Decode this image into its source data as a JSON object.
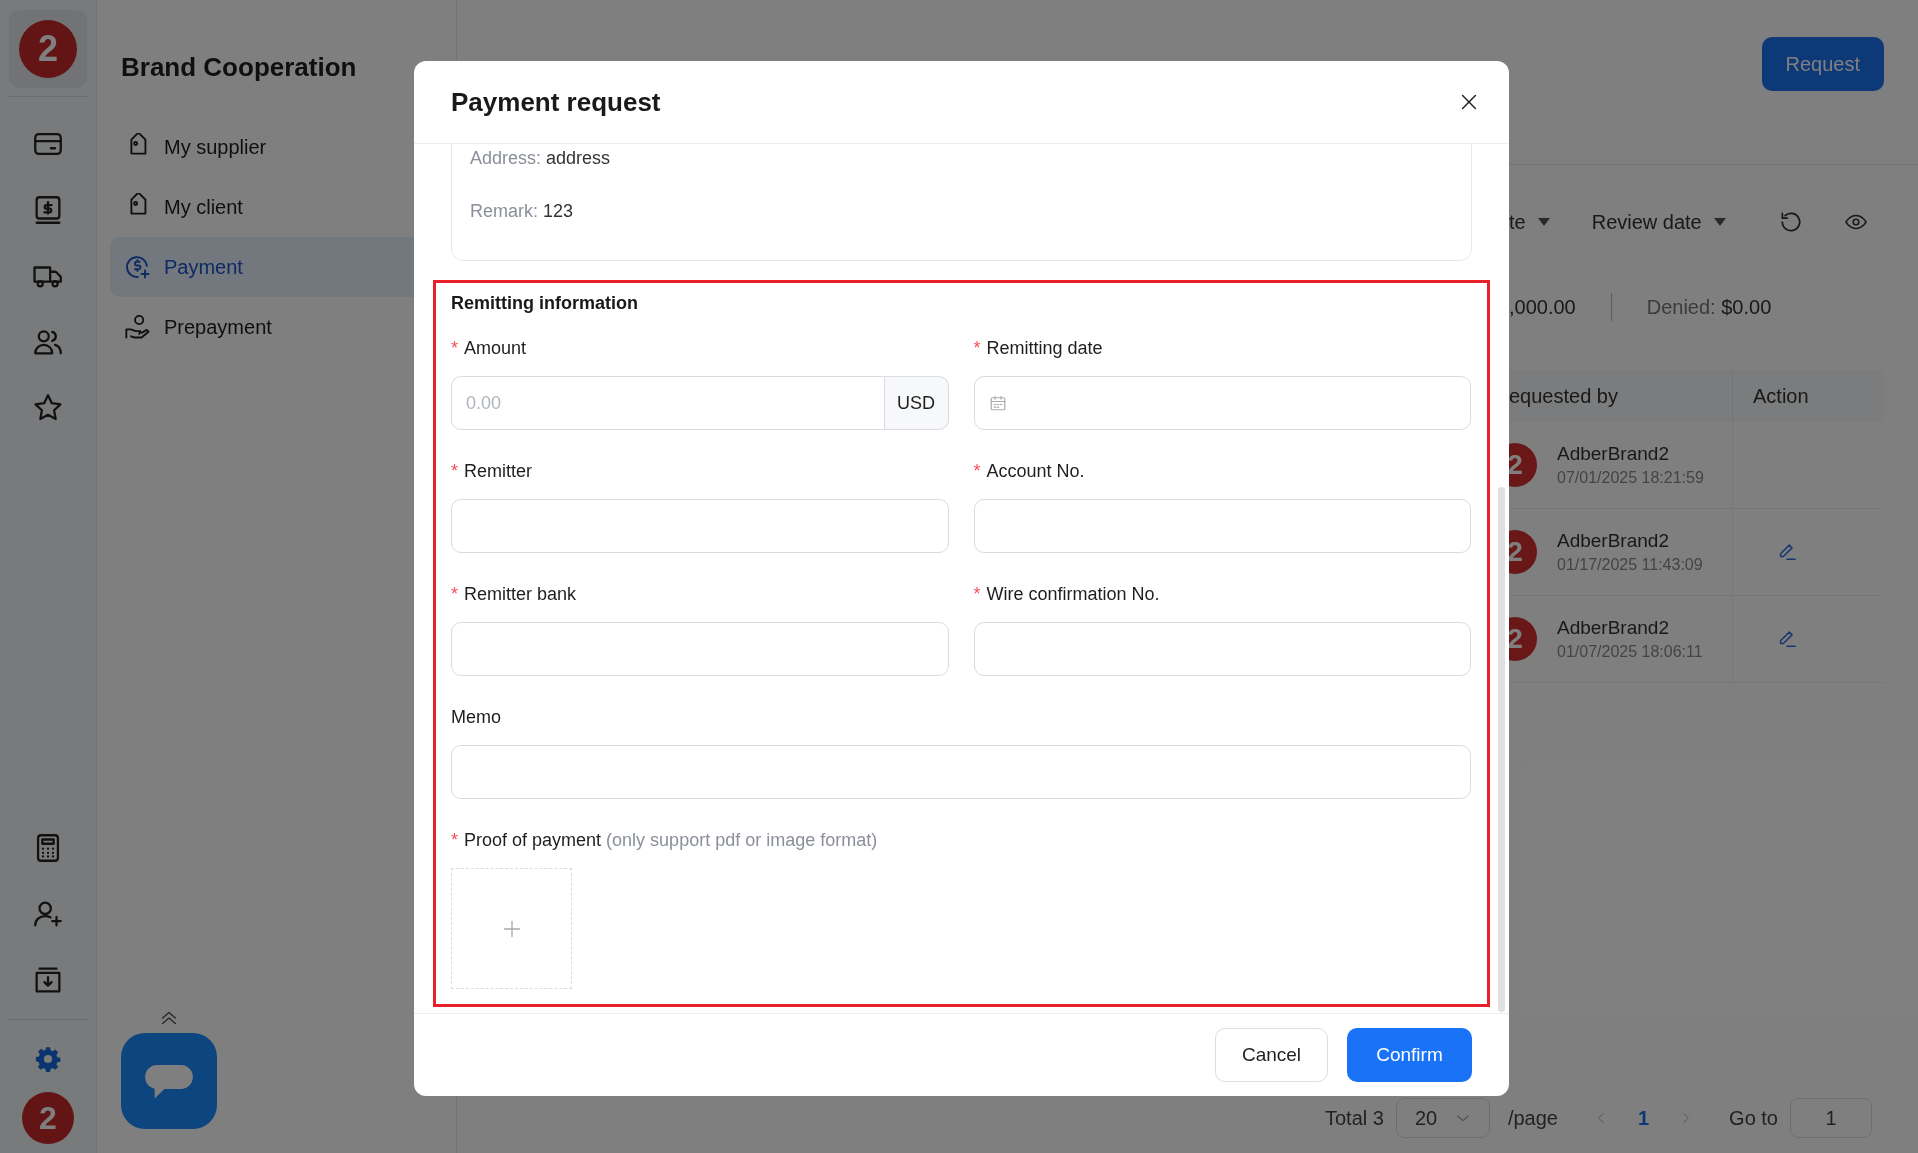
{
  "rail": {
    "logo": "2",
    "avatar": "2"
  },
  "nav": {
    "title": "Brand Cooperation",
    "items": [
      {
        "label": "My supplier",
        "selected": false
      },
      {
        "label": "My client",
        "selected": false
      },
      {
        "label": "Payment",
        "selected": true
      },
      {
        "label": "Prepayment",
        "selected": false
      }
    ]
  },
  "page": {
    "request_button": "Request",
    "filters": [
      {
        "label": "te"
      },
      {
        "label": "Review date"
      }
    ],
    "summary": [
      {
        "value": ",000.00"
      },
      {
        "label": "Denied:",
        "value": "$0.00"
      }
    ],
    "table": {
      "columns": [
        "equested by",
        "Action"
      ],
      "rows": [
        {
          "avatar": "2",
          "name": "AdberBrand2",
          "date": "07/01/2025 18:21:59",
          "editable": false
        },
        {
          "avatar": "2",
          "name": "AdberBrand2",
          "date": "01/17/2025 11:43:09",
          "editable": true
        },
        {
          "avatar": "2",
          "name": "AdberBrand2",
          "date": "01/07/2025 18:06:11",
          "editable": true
        }
      ]
    },
    "pagination": {
      "total": "Total 3",
      "page_size": "20",
      "per_page": "/page",
      "pages": [
        {
          "label": "1",
          "selected": true
        }
      ],
      "goto_label": "Go to",
      "goto_value": "1"
    }
  },
  "modal": {
    "title": "Payment request",
    "info": [
      {
        "label": "Address:",
        "value": "address"
      },
      {
        "label": "Remark:",
        "value": "123"
      }
    ],
    "section_title": "Remitting information",
    "section_highlighted": true,
    "fields": [
      {
        "kind": "amount",
        "marker": "*",
        "label": "Amount",
        "placeholder": "0.00",
        "suffix": "USD"
      },
      {
        "kind": "date",
        "marker": "*",
        "label": "Remitting date"
      },
      {
        "kind": "text",
        "marker": "*",
        "label": "Remitter"
      },
      {
        "kind": "text",
        "marker": "*",
        "label": "Account No."
      },
      {
        "kind": "text",
        "marker": "*",
        "label": "Remitter bank"
      },
      {
        "kind": "text",
        "marker": "*",
        "label": "Wire confirmation No."
      },
      {
        "kind": "wide",
        "label": "Memo"
      },
      {
        "kind": "upload",
        "marker": "*",
        "label": "Proof of payment",
        "hint": "(only support pdf or image format)"
      }
    ],
    "buttons": [
      {
        "label": "Cancel",
        "primary": false
      },
      {
        "label": "Confirm",
        "primary": true
      }
    ]
  }
}
